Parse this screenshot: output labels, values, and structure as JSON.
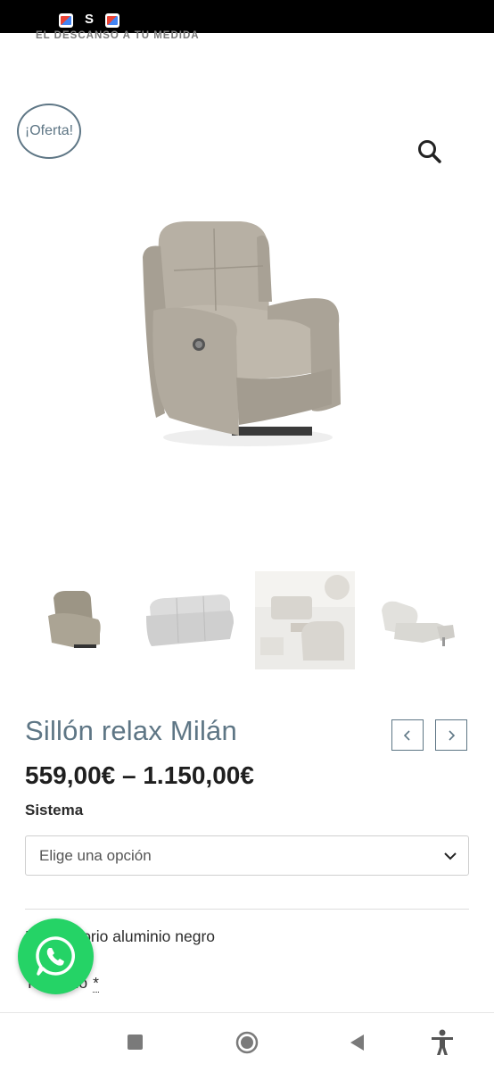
{
  "status_bar": {
    "icons": [
      "gmail-icon",
      "gmail-icon"
    ],
    "letter": "S"
  },
  "brand": {
    "tagline": "EL DESCANSO A TU MEDIDA"
  },
  "badge": {
    "text": "¡Oferta!"
  },
  "product": {
    "title": "Sillón relax Milán",
    "price": "559,00€ – 1.150,00€",
    "gallery": {
      "active_index": 2,
      "thumbnails": [
        "armchair-thumbnail",
        "sofa-thumbnail",
        "living-room-thumbnail",
        "reclined-armchair-thumbnail"
      ]
    }
  },
  "form": {
    "sistema_label": "Sistema",
    "sistema_select": "Elige una opción",
    "option_text": "Pie giratorio aluminio negro",
    "field_label": "Tapizado",
    "required_mark": "*"
  },
  "colors": {
    "accent": "#5e7685",
    "whatsapp": "#25d366"
  }
}
